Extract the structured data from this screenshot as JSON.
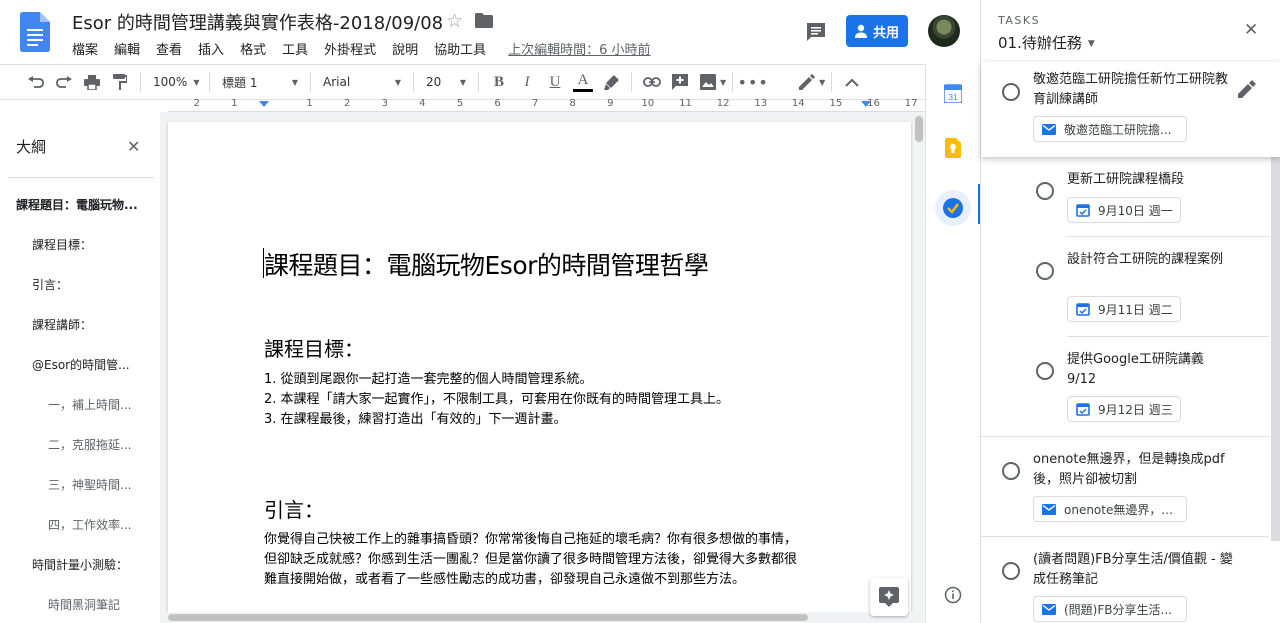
{
  "header": {
    "title": "Esor 的時間管理講義與實作表格-2018/09/08",
    "menu": [
      "檔案",
      "編輯",
      "查看",
      "插入",
      "格式",
      "工具",
      "外掛程式",
      "說明",
      "協助工具"
    ],
    "last_edit": "上次編輯時間：6 小時前",
    "share_label": "共用"
  },
  "toolbar": {
    "zoom": "100%",
    "style": "標題 1",
    "font": "Arial",
    "size": "20"
  },
  "ruler": {
    "numbers": [
      "2",
      "1",
      "",
      "1",
      "2",
      "3",
      "4",
      "5",
      "6",
      "7",
      "8",
      "9",
      "10",
      "11",
      "12",
      "13",
      "14",
      "15",
      "16",
      "17"
    ]
  },
  "outline": {
    "title": "大綱",
    "items": [
      {
        "level": 1,
        "text": "課程題目：電腦玩物..."
      },
      {
        "level": 2,
        "text": "課程目標："
      },
      {
        "level": 2,
        "text": "引言："
      },
      {
        "level": 2,
        "text": "課程講師："
      },
      {
        "level": 2,
        "text": "@Esor的時間管..."
      },
      {
        "level": 3,
        "text": "一，補上時間..."
      },
      {
        "level": 3,
        "text": "二，克服拖延..."
      },
      {
        "level": 3,
        "text": "三，神聖時間..."
      },
      {
        "level": 3,
        "text": "四，工作效率..."
      },
      {
        "level": 2,
        "text": "時間計量小測驗："
      },
      {
        "level": 3,
        "text": "時間黑洞筆記"
      }
    ]
  },
  "document": {
    "title": "課程題目：電腦玩物Esor的時間管理哲學",
    "section1_heading": "課程目標：",
    "section1_lines": [
      "1. 從頭到尾跟你一起打造一套完整的個人時間管理系統。",
      "2. 本課程「請大家一起實作」，不限制工具，可套用在你既有的時間管理工具上。",
      "3. 在課程最後，練習打造出「有效的」下一週計畫。"
    ],
    "section2_heading": "引言：",
    "section2_lines": [
      "你覺得自己快被工作上的雜事搞昏頭？你常常後悔自己拖延的壞毛病？你有很多想做的事情，",
      "但卻缺乏成就感？你感到生活一團亂？但是當你讀了很多時間管理方法後，卻覺得大多數都很",
      "難直接開始做，或者看了一些感性勵志的成功書，卻發現自己永遠做不到那些方法。"
    ]
  },
  "side_strip": {
    "calendar_day": "31"
  },
  "tasks": {
    "label": "TASKS",
    "list_name": "01.待辦任務",
    "items": [
      {
        "text": "敬邀范臨工研院擔任新竹工研院教育訓練講師",
        "chip": "敬邀范臨工研院擔..."
      },
      {
        "text": "更新工研院課程橋段",
        "chip": "9月10日 週一"
      },
      {
        "text": "設計符合工研院的課程案例",
        "chip": "9月11日 週二"
      },
      {
        "text": "提供Google工研院講義9/12",
        "chip": "9月12日 週三"
      },
      {
        "text": "onenote無邊界，但是轉換成pdf後，照片卻被切割",
        "chip": "onenote無邊界，..."
      },
      {
        "text": "(讀者問題)FB分享生活/價值觀 - 變成任務筆記",
        "chip": "(問題)FB分享生活..."
      }
    ]
  },
  "colors": {
    "accent": "#1a73e8",
    "doc_blue": "#4285f4",
    "keep_yellow": "#fbbc04"
  }
}
